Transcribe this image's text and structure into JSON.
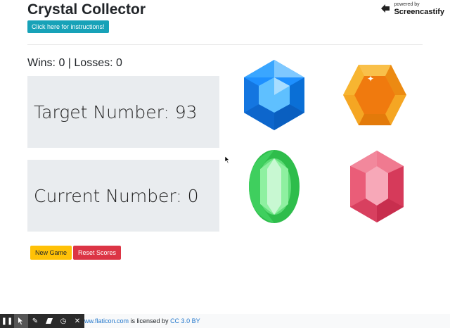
{
  "header": {
    "title": "Crystal Collector",
    "instructions_button": "Click here for instructions!"
  },
  "scoreboard": {
    "wins_label": "Wins:",
    "wins": 0,
    "losses_label": "Losses:",
    "losses": 0,
    "text": "Wins: 0 | Losses: 0"
  },
  "target": {
    "text": "Target Number: 93",
    "value": 93
  },
  "current": {
    "text": "Current Number: 0",
    "value": 0
  },
  "controls": {
    "new_game": "New Game",
    "reset_scores": "Reset Scores"
  },
  "crystals": [
    {
      "name": "blue",
      "icon": "blue-hexagon-gem",
      "color": "#1e90ff"
    },
    {
      "name": "orange",
      "icon": "orange-hexagon-gem",
      "color": "#f08c1a"
    },
    {
      "name": "green",
      "icon": "green-oval-gem",
      "color": "#3ecf5a"
    },
    {
      "name": "pink",
      "icon": "pink-hexagon-gem",
      "color": "#e8506e"
    }
  ],
  "watermark": {
    "small": "powered by",
    "brand": "Screencastify"
  },
  "footer": {
    "link1": "ww.flaticon.com",
    "middle": " is licensed by ",
    "link2": "CC 3.0 BY"
  },
  "toolbar": {
    "icons": [
      "pause-icon",
      "pointer-icon",
      "pen-icon",
      "eraser-icon",
      "timer-icon",
      "close-icon"
    ]
  }
}
